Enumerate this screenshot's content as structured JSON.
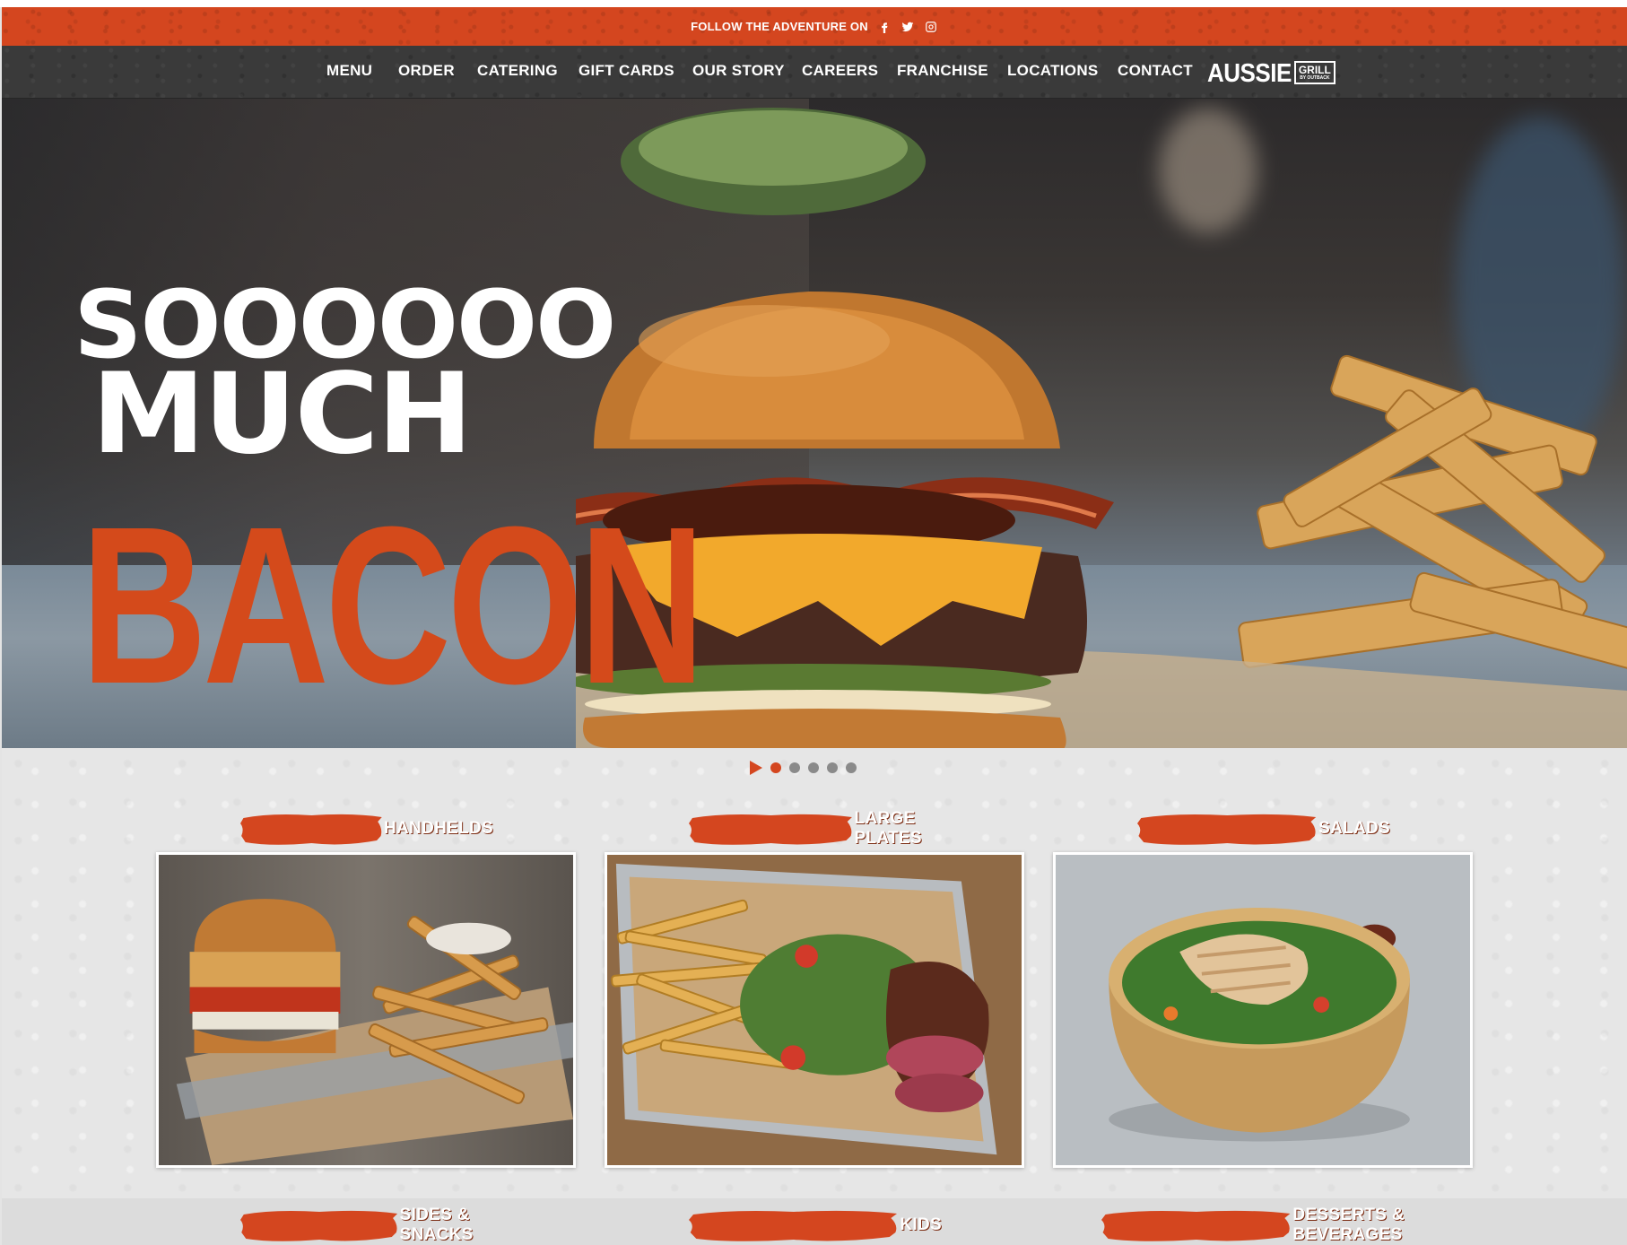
{
  "social_bar": {
    "text": "FOLLOW THE ADVENTURE ON",
    "icons": [
      "facebook-icon",
      "twitter-icon",
      "instagram-icon"
    ]
  },
  "nav": {
    "items": [
      "MENU",
      "ORDER",
      "CATERING",
      "GIFT CARDS",
      "OUR STORY",
      "CAREERS",
      "FRANCHISE",
      "LOCATIONS",
      "CONTACT"
    ],
    "logo": {
      "main": "AUSSIE",
      "box_top": "GRILL",
      "box_bottom": "BY OUTBACK"
    }
  },
  "hero": {
    "line1": "SOOOOOO",
    "line2": "MUCH",
    "line3": "BACON"
  },
  "carousel": {
    "slide_count": 5,
    "active_index": 0
  },
  "menu_categories": [
    {
      "label": "HANDHELDS"
    },
    {
      "label": "LARGE PLATES"
    },
    {
      "label": "SALADS"
    },
    {
      "label": "SIDES & SNACKS"
    },
    {
      "label": "KIDS"
    },
    {
      "label": "DESSERTS & BEVERAGES"
    }
  ],
  "colors": {
    "brand_orange": "#d4461f",
    "nav_dark": "#3a3a3a",
    "text_white": "#ffffff"
  }
}
